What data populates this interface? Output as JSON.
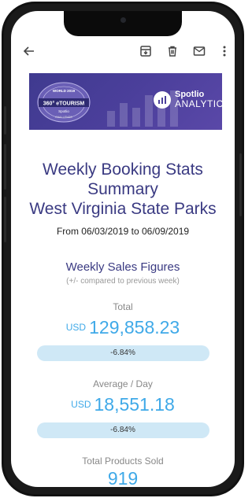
{
  "toolbar": {
    "icons": [
      "back-arrow-icon",
      "archive-icon",
      "trash-icon",
      "mail-icon",
      "more-vert-icon"
    ]
  },
  "banner": {
    "badge_lines": [
      "WORLD 2019",
      "360° eTOURISM",
      "Spotlio",
      "CHALLENGE"
    ],
    "brand_name": "Spotlio",
    "brand_suffix": "ANALYTICS",
    "colors": {
      "bg": "#4b3f9b",
      "text": "#ffffff"
    }
  },
  "report": {
    "title_line1": "Weekly Booking Stats",
    "title_line2": "Summary",
    "title_line3": "West Virginia State Parks",
    "date_range": "From 06/03/2019 to 06/09/2019",
    "section_title": "Weekly Sales Figures",
    "section_subtitle": "(+/- compared to previous week)"
  },
  "metrics": [
    {
      "label": "Total",
      "currency": "USD",
      "value": "129,858.23",
      "change": "-6.84%"
    },
    {
      "label": "Average / Day",
      "currency": "USD",
      "value": "18,551.18",
      "change": "-6.84%"
    },
    {
      "label": "Total Products Sold",
      "currency": "",
      "value": "919",
      "change": ""
    }
  ],
  "colors": {
    "title": "#3a3a82",
    "value": "#3fa9e8",
    "pill_bg": "#cfe8f6"
  }
}
